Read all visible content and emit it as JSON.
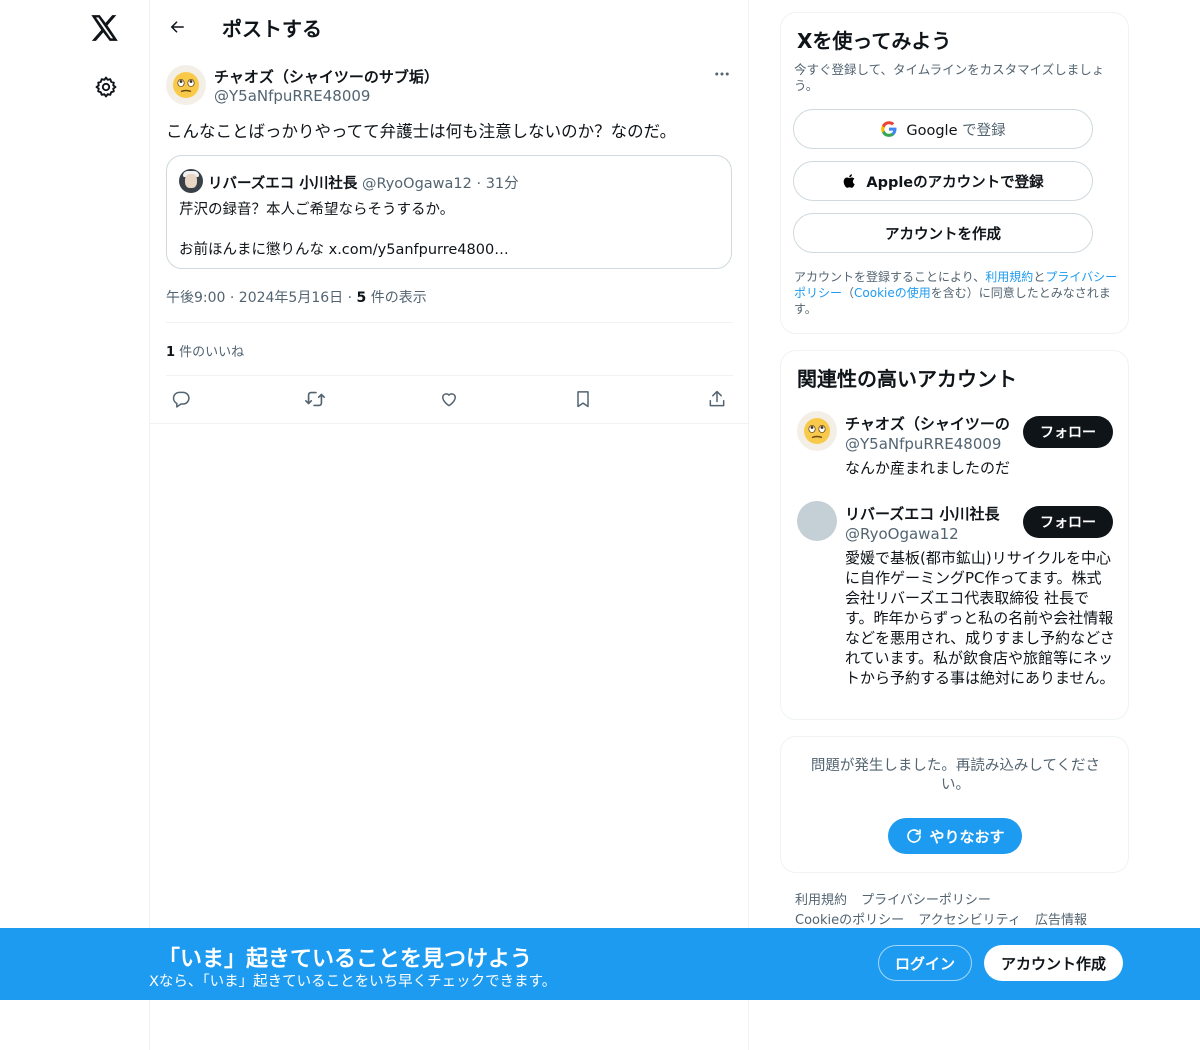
{
  "header": {
    "title": "ポストする"
  },
  "post": {
    "author_name": "チャオズ（シャイツーのサブ垢）",
    "author_handle": "@Y5aNfpuRRE48009",
    "text": "こんなことばっかりやってて弁護士は何も注意しないのか？なのだ。",
    "quote": {
      "name": "リバーズエコ 小川社長",
      "handle": "@RyoOgawa12",
      "separator": " · ",
      "time": "31分",
      "line1": "芹沢の録音？本人ご希望ならそうするか。",
      "line2": "お前ほんまに懲りんな x.com/y5anfpurre4800…"
    },
    "timestamp": "午後9:00 · 2024年5月16日",
    "separator": " · ",
    "views_count": "5",
    "views_label": " 件の表示",
    "likes_count": "1",
    "likes_label": " 件のいいね"
  },
  "signup": {
    "title": "Xを使ってみよう",
    "subtitle": "今すぐ登録して、タイムラインをカスタマイズしましょう。",
    "google_brand": "Google",
    "google_suffix": " で登録",
    "apple_label": "Appleのアカウントで登録",
    "create_label": "アカウントを作成",
    "legal_prefix": "アカウントを登録することにより、",
    "legal_terms": "利用規約",
    "legal_and": "と",
    "legal_privacy": "プライバシーポリシー",
    "legal_open": "（",
    "legal_cookie": "Cookieの使用",
    "legal_suffix": "を含む）に同意したとみなされます。"
  },
  "related": {
    "title": "関連性の高いアカウント",
    "accounts": [
      {
        "name": "チャオズ（シャイツーの",
        "handle": "@Y5aNfpuRRE48009",
        "bio": "なんか産まれましたのだ",
        "follow_label": "フォロー"
      },
      {
        "name": "リバーズエコ 小川社長",
        "handle": "@RyoOgawa12",
        "bio": "愛媛で基板(都市鉱山)リサイクルを中心に自作ゲーミングPC作ってます。株式会社リバーズエコ代表取締役 社長です。昨年からずっと私の名前や会社情報などを悪用され、成りすまし予約などされています。私が飲食店や旅館等にネットから予約する事は絶対にありません。",
        "follow_label": "フォロー"
      }
    ]
  },
  "error": {
    "text": "問題が発生しました。再読み込みしてください。",
    "retry_label": "やりなおす"
  },
  "footer": {
    "terms": "利用規約",
    "privacy": "プライバシーポリシー",
    "cookie": "Cookieのポリシー",
    "accessibility": "アクセシビリティ",
    "ads": "広告情報"
  },
  "banner": {
    "title": "「いま」起きていることを見つけよう",
    "subtitle": "Xなら、「いま」起きていることをいち早くチェックできます。",
    "login_label": "ログイン",
    "create_label": "アカウント作成"
  },
  "colors": {
    "brand_blue": "#1d9bf0",
    "text_primary": "#0f1419",
    "text_secondary": "#536471"
  },
  "icons": {
    "logo": "x-logo-icon",
    "settings": "gear-icon",
    "back": "arrow-left-icon",
    "more": "more-horizontal-icon",
    "reply": "reply-icon",
    "repost": "repost-icon",
    "like": "heart-icon",
    "bookmark": "bookmark-icon",
    "share": "share-icon",
    "google": "google-icon",
    "apple": "apple-icon",
    "retry": "refresh-icon"
  }
}
